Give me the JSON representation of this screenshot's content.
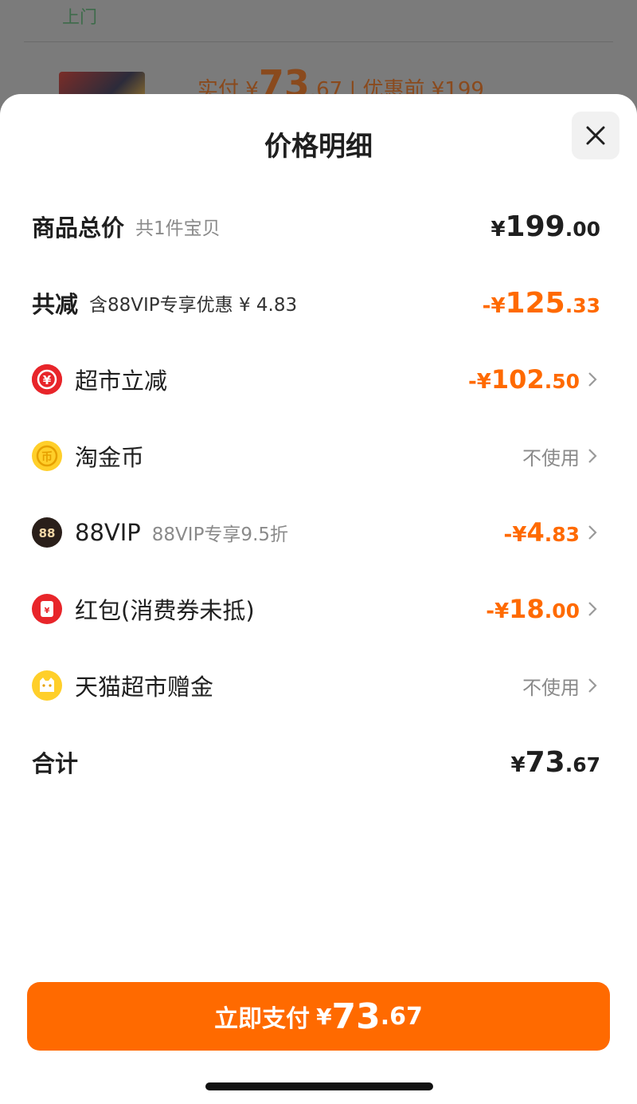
{
  "background": {
    "top_label": "上门",
    "price_prefix": "实付 ¥",
    "price_int": "73",
    "price_dec": ".67",
    "price_suffix": "| 优惠前 ¥199"
  },
  "sheet": {
    "title": "价格明细",
    "close_icon": "close-icon"
  },
  "summary": {
    "total_label": "商品总价",
    "total_sub": "共1件宝贝",
    "total_cur": "¥",
    "total_int": "199",
    "total_dec": ".00",
    "reduce_label": "共减",
    "reduce_sub": "含88VIP专享优惠 ¥ 4.83",
    "reduce_cur": "-¥",
    "reduce_int": "125",
    "reduce_dec": ".33"
  },
  "discounts": [
    {
      "label": "超市立减",
      "sub": "",
      "icon": "rmb-refund-icon",
      "cur": "-¥",
      "int": "102",
      "dec": ".50",
      "status": ""
    },
    {
      "label": "淘金币",
      "sub": "",
      "icon": "gold-coin-icon",
      "cur": "",
      "int": "",
      "dec": "",
      "status": "不使用"
    },
    {
      "label": "88VIP",
      "sub": "88VIP专享9.5折",
      "icon": "vip88-icon",
      "cur": "-¥",
      "int": "4",
      "dec": ".83",
      "status": ""
    },
    {
      "label": "红包(消费券未抵)",
      "sub": "",
      "icon": "red-packet-icon",
      "cur": "-¥",
      "int": "18",
      "dec": ".00",
      "status": ""
    },
    {
      "label": "天猫超市赠金",
      "sub": "",
      "icon": "tmall-cat-icon",
      "cur": "",
      "int": "",
      "dec": "",
      "status": "不使用"
    }
  ],
  "total": {
    "label": "合计",
    "cur": "¥",
    "int": "73",
    "dec": ".67"
  },
  "pay_button": {
    "label": "立即支付",
    "cur": "¥",
    "int": "73",
    "dec": ".67"
  },
  "colors": {
    "accent": "#ff6a00",
    "text": "#1f1f1f",
    "muted": "#8a8a8a"
  }
}
